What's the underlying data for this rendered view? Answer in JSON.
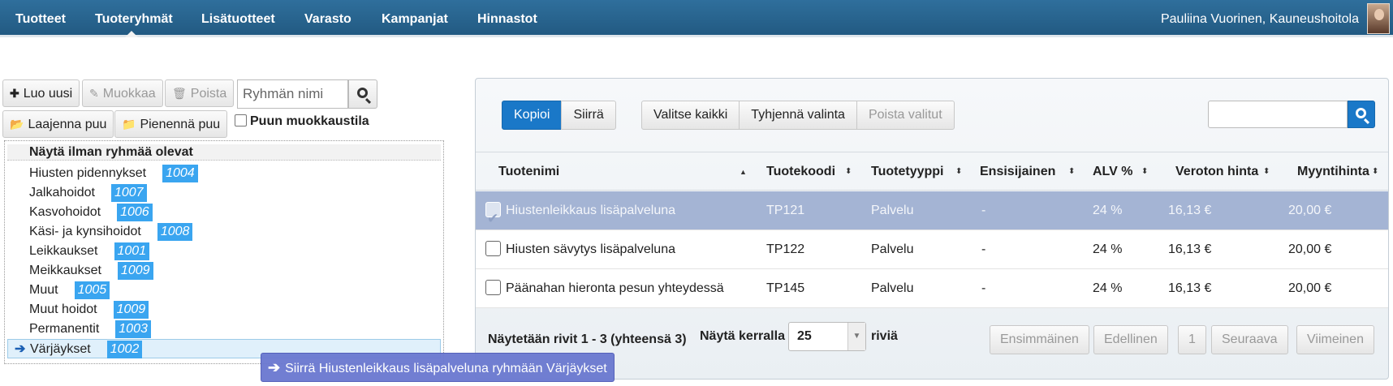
{
  "nav": {
    "items": [
      "Tuotteet",
      "Tuoteryhmät",
      "Lisätuotteet",
      "Varasto",
      "Kampanjat",
      "Hinnastot"
    ],
    "active_index": 1,
    "user": "Pauliina Vuorinen, Kauneushoitola"
  },
  "toolbar": {
    "create": "Luo uusi",
    "edit": "Muokkaa",
    "delete": "Poista",
    "search_placeholder": "Ryhmän nimi",
    "expand": "Laajenna puu",
    "collapse": "Pienennä puu",
    "edit_mode": "Puun muokkaustila"
  },
  "tree": {
    "root": "Näytä ilman ryhmää olevat",
    "items": [
      {
        "name": "Hiusten pidennykset",
        "id": "1004"
      },
      {
        "name": "Jalkahoidot",
        "id": "1007"
      },
      {
        "name": "Kasvohoidot",
        "id": "1006"
      },
      {
        "name": "Käsi- ja kynsihoidot",
        "id": "1008"
      },
      {
        "name": "Leikkaukset",
        "id": "1001"
      },
      {
        "name": "Meikkaukset",
        "id": "1009"
      },
      {
        "name": "Muut",
        "id": "1005"
      },
      {
        "name": "Muut hoidot",
        "id": "1009"
      },
      {
        "name": "Permanentit",
        "id": "1003"
      },
      {
        "name": "Värjäykset",
        "id": "1002"
      }
    ],
    "selected_index": 9
  },
  "drag_tooltip": "Siirrä Hiustenleikkaus lisäpalveluna ryhmään Värjäykset",
  "panel": {
    "copy": "Kopioi",
    "move": "Siirrä",
    "select_all": "Valitse kaikki",
    "clear_selection": "Tyhjennä valinta",
    "remove_selected": "Poista valitut",
    "columns": [
      "Tuotenimi",
      "Tuotekoodi",
      "Tuotetyyppi",
      "Ensisijainen",
      "ALV %",
      "Veroton hinta",
      "Myyntihinta"
    ],
    "rows": [
      {
        "name": "Hiustenleikkaus lisäpalveluna",
        "code": "TP121",
        "type": "Palvelu",
        "primary": "-",
        "vat": "24 %",
        "net": "16,13 €",
        "price": "20,00 €",
        "checked": true
      },
      {
        "name": "Hiusten sävytys lisäpalveluna",
        "code": "TP122",
        "type": "Palvelu",
        "primary": "-",
        "vat": "24 %",
        "net": "16,13 €",
        "price": "20,00 €",
        "checked": false
      },
      {
        "name": "Päänahan hieronta pesun yhteydessä",
        "code": "TP145",
        "type": "Palvelu",
        "primary": "-",
        "vat": "24 %",
        "net": "16,13 €",
        "price": "20,00 €",
        "checked": false
      }
    ],
    "showing": "Näytetään rivit 1 - 3 (yhteensä 3)",
    "per_page_label": "Näytä kerralla",
    "per_page": "25",
    "rows_word": "riviä",
    "pager": {
      "first": "Ensimmäinen",
      "prev": "Edellinen",
      "page": "1",
      "next": "Seuraava",
      "last": "Viimeinen"
    }
  },
  "colors": {
    "nav_bg": "#2a6690",
    "accent": "#1a78c8",
    "badge": "#3aa5f0",
    "selected_row": "#a4b4d4",
    "tooltip": "#6a78d0"
  }
}
